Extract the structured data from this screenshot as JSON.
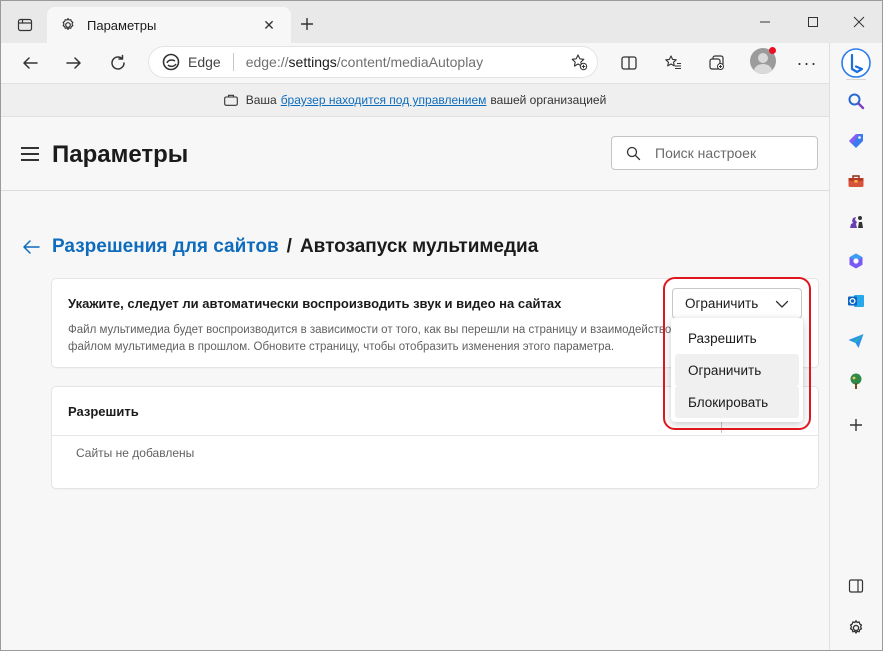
{
  "tab": {
    "title": "Параметры",
    "close": "✕"
  },
  "window": {
    "minimize": "—",
    "maximize": "☐",
    "close": "✕"
  },
  "address": {
    "brand": "Edge",
    "url_prefix": "edge://",
    "url_host": "settings",
    "url_path": "/content/mediaAutoplay"
  },
  "toolbar": {
    "more": "···"
  },
  "managed": {
    "before": "Ваша",
    "link": "браузер находится под управлением",
    "after": "вашей организацией"
  },
  "header": {
    "title": "Параметры",
    "search_placeholder": "Поиск настроек"
  },
  "breadcrumb": {
    "parent": "Разрешения для сайтов",
    "separator": "/",
    "current": "Автозапуск мультимедиа"
  },
  "autoplay": {
    "title": "Укажите, следует ли автоматически воспроизводить звук и видео на сайтах",
    "desc_line1": "Файл мультимедиа будет воспроизводится в зависимости от того, как вы перешли на страницу и взаимодействовали с",
    "desc_line2": "файлом мультимедиа в прошлом. Обновите страницу, чтобы отобразить изменения этого параметра.",
    "selected": "Ограничить",
    "options": [
      "Разрешить",
      "Ограничить",
      "Блокировать"
    ]
  },
  "allow": {
    "header": "Разрешить",
    "empty": "Сайты не добавлены"
  },
  "colors": {
    "accent": "#0f6cbd",
    "highlight": "#e0161e"
  }
}
